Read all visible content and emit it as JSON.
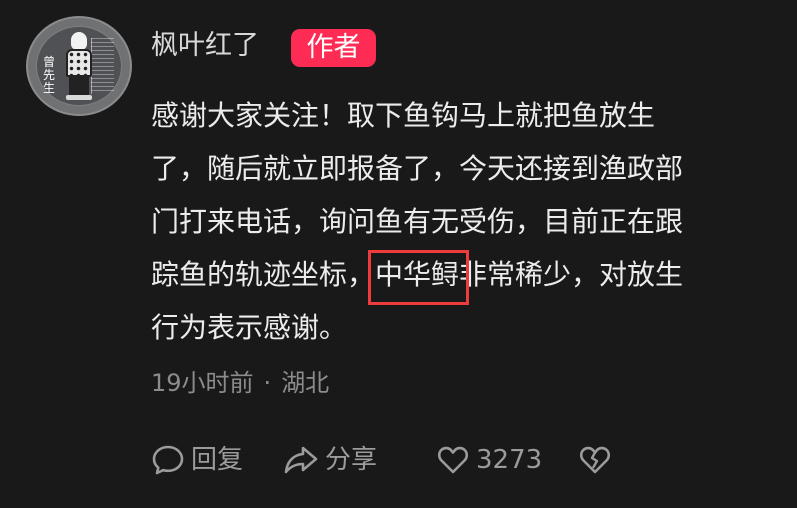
{
  "comment": {
    "author": {
      "name": "枫叶红了",
      "badge": "作者",
      "avatar_text": "曾先生"
    },
    "text_lines": [
      "感谢大家关注！取下鱼钩马上就把鱼放生",
      "了，随后就立即报备了，今天还接到渔政部",
      "门打来电话，询问鱼有无受伤，目前正在跟"
    ],
    "line4_before": "踪鱼的轨迹坐标，",
    "line4_highlight": "中华鲟",
    "line4_after": "非常稀少，对放生",
    "line5": "行为表示感谢。",
    "meta": {
      "time": "19小时前",
      "separator": "·",
      "location": "湖北"
    },
    "actions": {
      "reply_icon": "speech-bubble-icon",
      "reply": "回复",
      "share_icon": "share-arrow-icon",
      "share": "分享",
      "like_icon": "heart-icon",
      "like_count": "3273",
      "dislike_icon": "broken-heart-icon"
    }
  },
  "colors": {
    "background": "#1a1919",
    "text": "#ececec",
    "secondary": "#8c8c8c",
    "badge": "#fe2c55",
    "highlight_box": "#ee3b3b"
  }
}
